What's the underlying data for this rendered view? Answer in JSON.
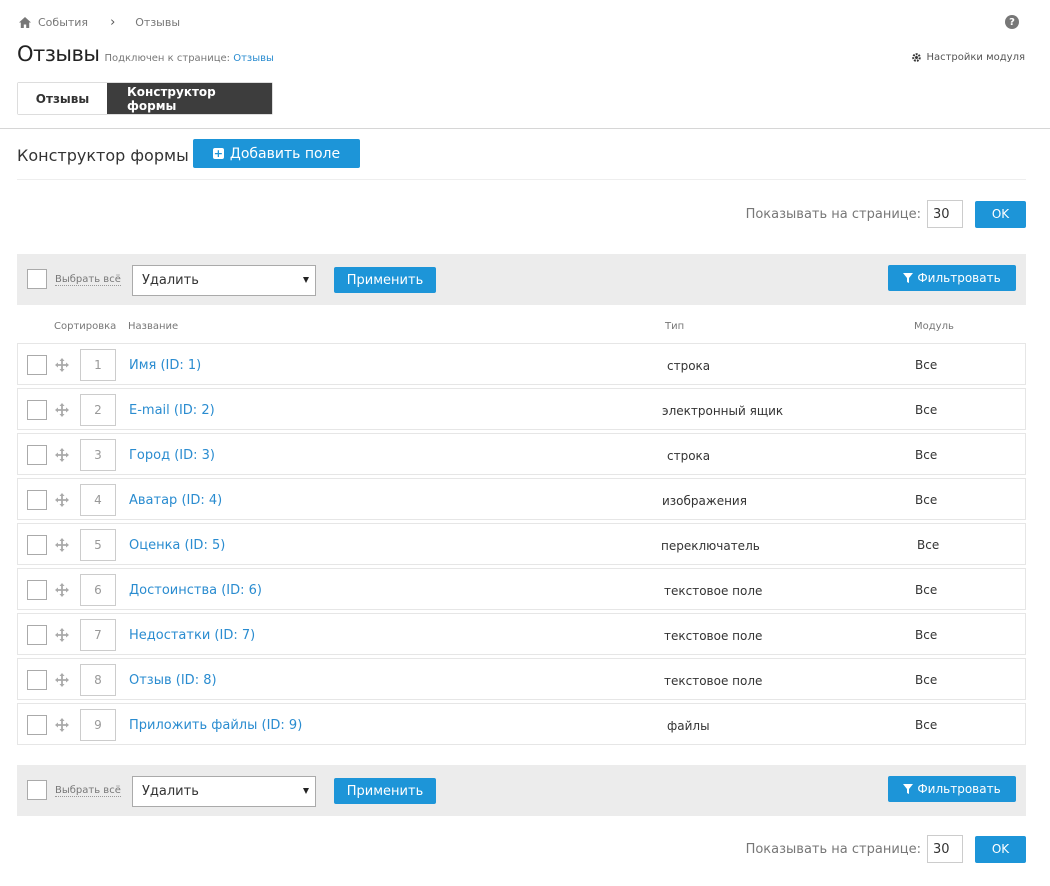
{
  "breadcrumb": {
    "home": "События",
    "current": "Отзывы"
  },
  "header": {
    "title": "Отзывы",
    "subtitle_prefix": "Подключен к странице:",
    "subtitle_link": "Отзывы",
    "module_settings": "Настройки модуля",
    "help": "?"
  },
  "tabs": [
    {
      "label": "Отзывы",
      "active": false
    },
    {
      "label": "Конструктор формы",
      "active": true
    }
  ],
  "section": {
    "title": "Конструктор формы",
    "add_button": "Добавить поле"
  },
  "perpage": {
    "label": "Показывать на странице:",
    "value": "30",
    "ok": "OK"
  },
  "bulk": {
    "select_all": "Выбрать всё",
    "action": "Удалить",
    "apply": "Применить",
    "filter": "Фильтровать"
  },
  "columns": {
    "sort": "Сортировка",
    "name": "Название",
    "type": "Тип",
    "module": "Модуль"
  },
  "rows": [
    {
      "sort": "1",
      "name": "Имя (ID: 1)",
      "type": "строка",
      "module": "Все"
    },
    {
      "sort": "2",
      "name": "E-mail (ID: 2)",
      "type": "электронный ящик",
      "module": "Все"
    },
    {
      "sort": "3",
      "name": "Город (ID: 3)",
      "type": "строка",
      "module": "Все"
    },
    {
      "sort": "4",
      "name": "Аватар (ID: 4)",
      "type": "изображения",
      "module": "Все"
    },
    {
      "sort": "5",
      "name": "Оценка (ID: 5)",
      "type": "переключатель",
      "module": "Все"
    },
    {
      "sort": "6",
      "name": "Достоинства (ID: 6)",
      "type": "текстовое поле",
      "module": "Все"
    },
    {
      "sort": "7",
      "name": "Недостатки (ID: 7)",
      "type": "текстовое поле",
      "module": "Все"
    },
    {
      "sort": "8",
      "name": "Отзыв (ID: 8)",
      "type": "текстовое поле",
      "module": "Все"
    },
    {
      "sort": "9",
      "name": "Приложить файлы (ID: 9)",
      "type": "файлы",
      "module": "Все"
    }
  ],
  "colors": {
    "accent": "#1d95d8",
    "link": "#2a8cd0",
    "active_tab": "#3d3d3d",
    "bar_bg": "#ececec"
  }
}
